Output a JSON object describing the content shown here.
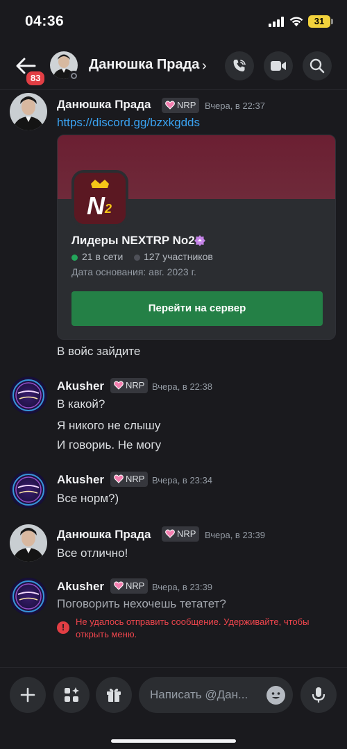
{
  "status_bar": {
    "time": "04:36",
    "battery": "31"
  },
  "header": {
    "unread_count": "83",
    "title": "Данюшка Прада",
    "chevron": "›"
  },
  "messages": [
    {
      "author": "Данюшка Прада",
      "tag": "NRP",
      "time": "Вчера, в 22:37",
      "lines": [
        "https://discord.gg/bzxkgdds"
      ],
      "invite": {
        "server_name": "Лидеры NEXTRP No2",
        "online": "21 в сети",
        "members": "127 участников",
        "founded": "Дата основания: авг. 2023 г.",
        "join_label": "Перейти на сервер",
        "icon_text": "№2"
      },
      "after_line": "В войс зайдите"
    },
    {
      "author": "Akusher",
      "tag": "NRP",
      "time": "Вчера, в 22:38",
      "lines": [
        "В какой?",
        "Я никого не слышу",
        "И говориь. Не могу"
      ]
    },
    {
      "author": "Akusher",
      "tag": "NRP",
      "time": "Вчера, в 23:34",
      "lines": [
        "Все норм?)"
      ]
    },
    {
      "author": "Данюшка Прада",
      "tag": "NRP",
      "time": "Вчера, в 23:39",
      "lines": [
        "Все отлично!"
      ]
    },
    {
      "author": "Akusher",
      "tag": "NRP",
      "time": "Вчера, в 23:39",
      "lines": [
        "Поговорить нехочешь тетатет?"
      ],
      "error": "Не удалось отправить сообщение. Удерживайте, чтобы открыть меню."
    }
  ],
  "composer": {
    "placeholder": "Написать @Дан..."
  },
  "colors": {
    "accent_link": "#3aa3f2",
    "join_button": "#248046",
    "error": "#f0464d",
    "online": "#23a55a"
  }
}
